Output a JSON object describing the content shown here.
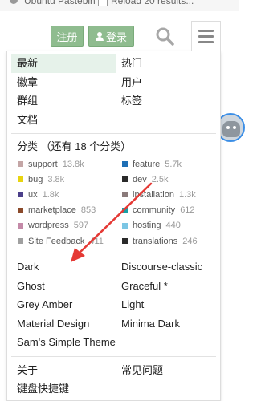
{
  "top_strip": {
    "left_text": "Ubuntu Pastebin",
    "right_text": "Reload 20 results..."
  },
  "header": {
    "register_label": "注册",
    "login_label": "登录",
    "search_icon": "search-icon",
    "menu_icon": "hamburger-icon"
  },
  "nav": {
    "links": [
      {
        "label": "最新",
        "active": true
      },
      {
        "label": "热门",
        "active": false
      },
      {
        "label": "徽章",
        "active": false
      },
      {
        "label": "用户",
        "active": false
      },
      {
        "label": "群组",
        "active": false
      },
      {
        "label": "标签",
        "active": false
      },
      {
        "label": "文档",
        "active": false
      }
    ]
  },
  "categories": {
    "heading": "分类 （还有 18 个分类）",
    "items": [
      {
        "name": "support",
        "count": "13.8k",
        "color": "#c4a6a6"
      },
      {
        "name": "feature",
        "count": "5.7k",
        "color": "#1f6fb5"
      },
      {
        "name": "bug",
        "count": "3.8k",
        "color": "#e8d410"
      },
      {
        "name": "dev",
        "count": "2.5k",
        "color": "#2a2a2a"
      },
      {
        "name": "ux",
        "count": "1.8k",
        "color": "#4b3f8a"
      },
      {
        "name": "installation",
        "count": "1.3k",
        "color": "#8a7a7a"
      },
      {
        "name": "marketplace",
        "count": "853",
        "color": "#8b4a2b"
      },
      {
        "name": "community",
        "count": "612",
        "color": "#17a0a6"
      },
      {
        "name": "wordpress",
        "count": "597",
        "color": "#c48aa8"
      },
      {
        "name": "hosting",
        "count": "440",
        "color": "#7cc6e4"
      },
      {
        "name": "Site Feedback",
        "count": "411",
        "color": "#a0a0a0"
      },
      {
        "name": "translations",
        "count": "246",
        "color": "#2a2a2a"
      }
    ]
  },
  "themes": {
    "items": [
      "Dark",
      "Discourse-classic",
      "Ghost",
      "Graceful *",
      "Grey Amber",
      "Light",
      "Material Design",
      "Minima Dark",
      "Sam's Simple Theme"
    ]
  },
  "footer_links": {
    "about": "关于",
    "faq": "常见问题",
    "shortcuts": "键盘快捷键"
  },
  "annotation": {
    "arrow_color": "#e53935"
  }
}
